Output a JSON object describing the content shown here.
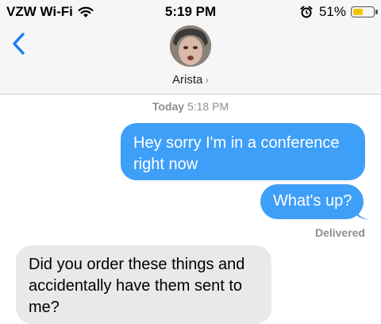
{
  "status_bar": {
    "carrier": "VZW Wi-Fi",
    "time": "5:19 PM",
    "battery_text": "51%",
    "battery_level": 0.51,
    "icons": [
      "wifi-icon",
      "alarm-icon",
      "battery-icon"
    ]
  },
  "nav": {
    "back_icon": "chevron-left-icon",
    "contact_name": "Arista",
    "contact_chevron": "›"
  },
  "thread": {
    "timestamp_day": "Today",
    "timestamp_time": "5:18 PM",
    "messages": [
      {
        "direction": "outgoing",
        "text": "Hey sorry I'm in a conference right now"
      },
      {
        "direction": "outgoing",
        "text": "What's up?"
      },
      {
        "direction": "incoming",
        "text": "Did you order these things and accidentally have them sent to me?"
      }
    ],
    "delivery_status": "Delivered"
  },
  "colors": {
    "outgoing_bubble": "#3e9ff8",
    "incoming_bubble": "#e9e9eb",
    "accent": "#1a7cf5",
    "battery_fill": "#f5c400"
  }
}
